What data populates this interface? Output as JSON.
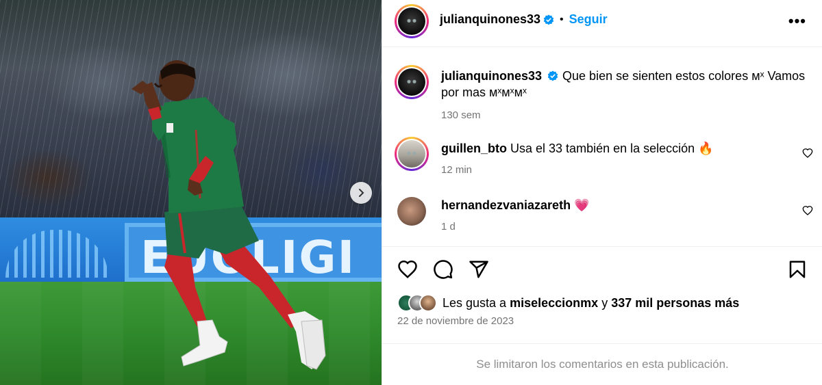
{
  "post": {
    "author": "julianquinones33",
    "follow_label": "Seguir",
    "more_label": "•••",
    "caption": "Que bien se sienten estos colores ᴍˣ Vamos por mas ᴍˣᴍˣᴍˣ",
    "caption_time": "130 sem",
    "board_text": "EUOLIGI",
    "comments": [
      {
        "user": "guillen_bto",
        "text": "Usa el 33 también en la selección 🔥",
        "time": "12 min"
      },
      {
        "user": "hernandezvaniazareth",
        "text": "💗",
        "time": "1 d"
      }
    ],
    "likes": {
      "prefix": "Les gusta a",
      "user": "miseleccionmx",
      "joiner": "y",
      "count": "337 mil personas más"
    },
    "date": "22 de noviembre de 2023",
    "comments_limited": "Se limitaron los comentarios en esta publicación."
  },
  "colors": {
    "link": "#0095f6",
    "verified": "#0095f6",
    "muted": "#737373",
    "like_heart": "#ff3b6b"
  },
  "icons": [
    "verified-badge-icon",
    "more-options-icon",
    "heart-icon",
    "comment-icon",
    "share-icon",
    "bookmark-icon",
    "next-arrow-icon"
  ]
}
